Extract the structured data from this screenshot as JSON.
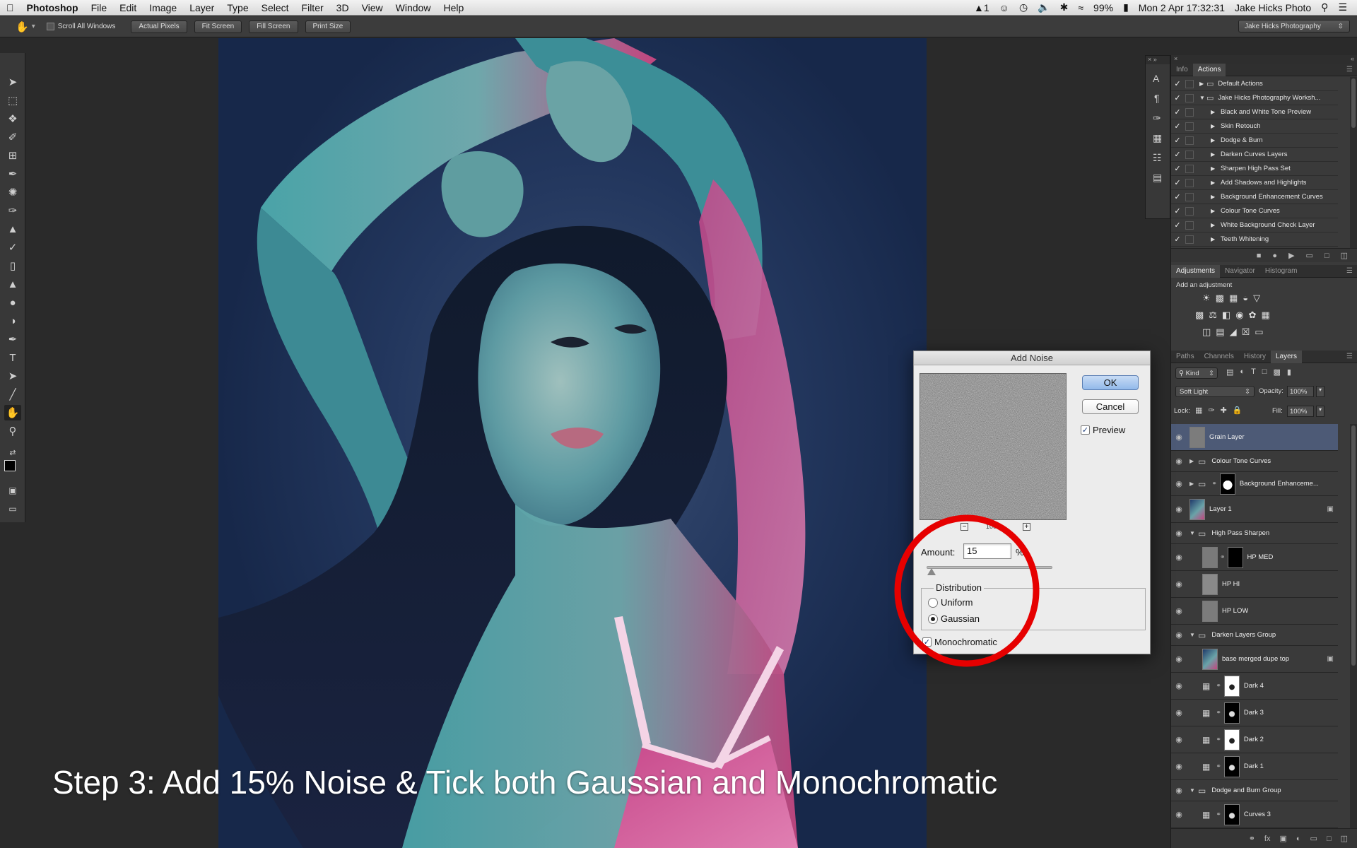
{
  "menubar": {
    "app": "Photoshop",
    "items": [
      "File",
      "Edit",
      "Image",
      "Layer",
      "Type",
      "Select",
      "Filter",
      "3D",
      "View",
      "Window",
      "Help"
    ],
    "status_badge": "1",
    "battery": "99%",
    "datetime": "Mon 2 Apr  17:32:31",
    "user": "Jake Hicks Photo"
  },
  "options": {
    "scroll_all_label": "Scroll All Windows",
    "buttons": [
      "Actual Pixels",
      "Fit Screen",
      "Fill Screen",
      "Print Size"
    ],
    "workspace": "Jake Hicks Photography"
  },
  "actions_panel": {
    "tabs": [
      "Info",
      "Actions"
    ],
    "items": [
      {
        "label": "Default Actions",
        "type": "set",
        "open": false
      },
      {
        "label": "Jake Hicks Photography Worksh...",
        "type": "set",
        "open": true
      },
      {
        "label": "Black and White Tone Preview",
        "type": "action"
      },
      {
        "label": "Skin Retouch",
        "type": "action"
      },
      {
        "label": "Dodge & Burn",
        "type": "action"
      },
      {
        "label": "Darken Curves Layers",
        "type": "action"
      },
      {
        "label": "Sharpen High Pass Set",
        "type": "action"
      },
      {
        "label": "Add Shadows and Highlights",
        "type": "action"
      },
      {
        "label": "Background Enhancement Curves",
        "type": "action"
      },
      {
        "label": "Colour Tone Curves",
        "type": "action"
      },
      {
        "label": "White Background Check Layer",
        "type": "action"
      },
      {
        "label": "Teeth Whitening",
        "type": "action"
      }
    ]
  },
  "adjust_panel": {
    "tabs": [
      "Adjustments",
      "Navigator",
      "Histogram"
    ],
    "hint": "Add an adjustment"
  },
  "layers_panel": {
    "tabs": [
      "Paths",
      "Channels",
      "History",
      "Layers"
    ],
    "filter_kind": "Kind",
    "blend_mode": "Soft Light",
    "opacity_label": "Opacity:",
    "opacity": "100%",
    "lock_label": "Lock:",
    "fill_label": "Fill:",
    "fill": "100%",
    "layers": [
      {
        "name": "Grain Layer",
        "kind": "layer",
        "selected": true
      },
      {
        "name": "Colour Tone Curves",
        "kind": "group"
      },
      {
        "name": "Background Enhanceme...",
        "kind": "group-mask"
      },
      {
        "name": "Layer 1",
        "kind": "photo"
      },
      {
        "name": "High Pass Sharpen",
        "kind": "group-open"
      },
      {
        "name": "HP MED",
        "kind": "mask"
      },
      {
        "name": "HP HI",
        "kind": "layer"
      },
      {
        "name": "HP LOW",
        "kind": "layer"
      },
      {
        "name": "Darken Layers Group",
        "kind": "group-open"
      },
      {
        "name": "base merged dupe top",
        "kind": "photo"
      },
      {
        "name": "Dark 4",
        "kind": "curve"
      },
      {
        "name": "Dark 3",
        "kind": "curve"
      },
      {
        "name": "Dark 2",
        "kind": "curve"
      },
      {
        "name": "Dark 1",
        "kind": "curve"
      },
      {
        "name": "Dodge and Burn Group",
        "kind": "group-open"
      },
      {
        "name": "Curves 3",
        "kind": "curve"
      }
    ]
  },
  "dialog": {
    "title": "Add Noise",
    "ok": "OK",
    "cancel": "Cancel",
    "preview": "Preview",
    "zoom": "100%",
    "amount_label": "Amount:",
    "amount": "15",
    "amount_unit": "%",
    "amount_slider_fraction": 0.04,
    "distribution_label": "Distribution",
    "uniform": "Uniform",
    "gaussian": "Gaussian",
    "distribution_selected": "Gaussian",
    "monochromatic": "Monochromatic"
  },
  "caption": "Step 3: Add 15% Noise & Tick both Gaussian and Monochromatic",
  "colors": {
    "highlight_circle": "#e60000",
    "selected_layer": "#4d5a76",
    "default_button": "#92b9ea"
  }
}
